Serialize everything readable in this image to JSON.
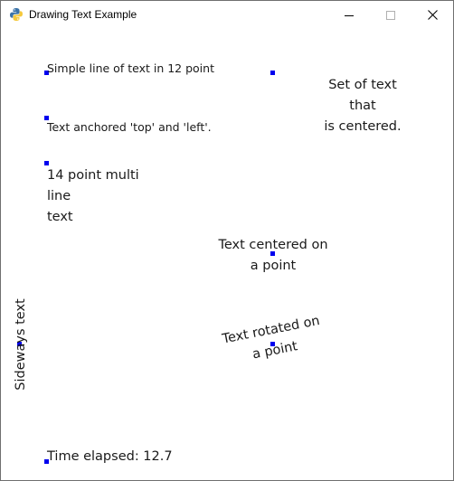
{
  "window": {
    "title": "Drawing Text Example",
    "icon": "python-icon",
    "controls": [
      "minimize-icon",
      "maximize-icon",
      "close-icon"
    ]
  },
  "canvas": {
    "simple_line": "Simple line of text in 12 point",
    "anchored": "Text anchored 'top' and 'left'.",
    "multiline": [
      "14 point multi",
      "line",
      "text"
    ],
    "centered_set": [
      "Set of text",
      "that",
      "is centered."
    ],
    "centered_point": [
      "Text centered on",
      "a point"
    ],
    "rotated_point": [
      "Text rotated on",
      "a point"
    ],
    "sideways": "Sideways text",
    "time_label": "Time elapsed:  12.7",
    "marker_color": "#0000ee"
  }
}
